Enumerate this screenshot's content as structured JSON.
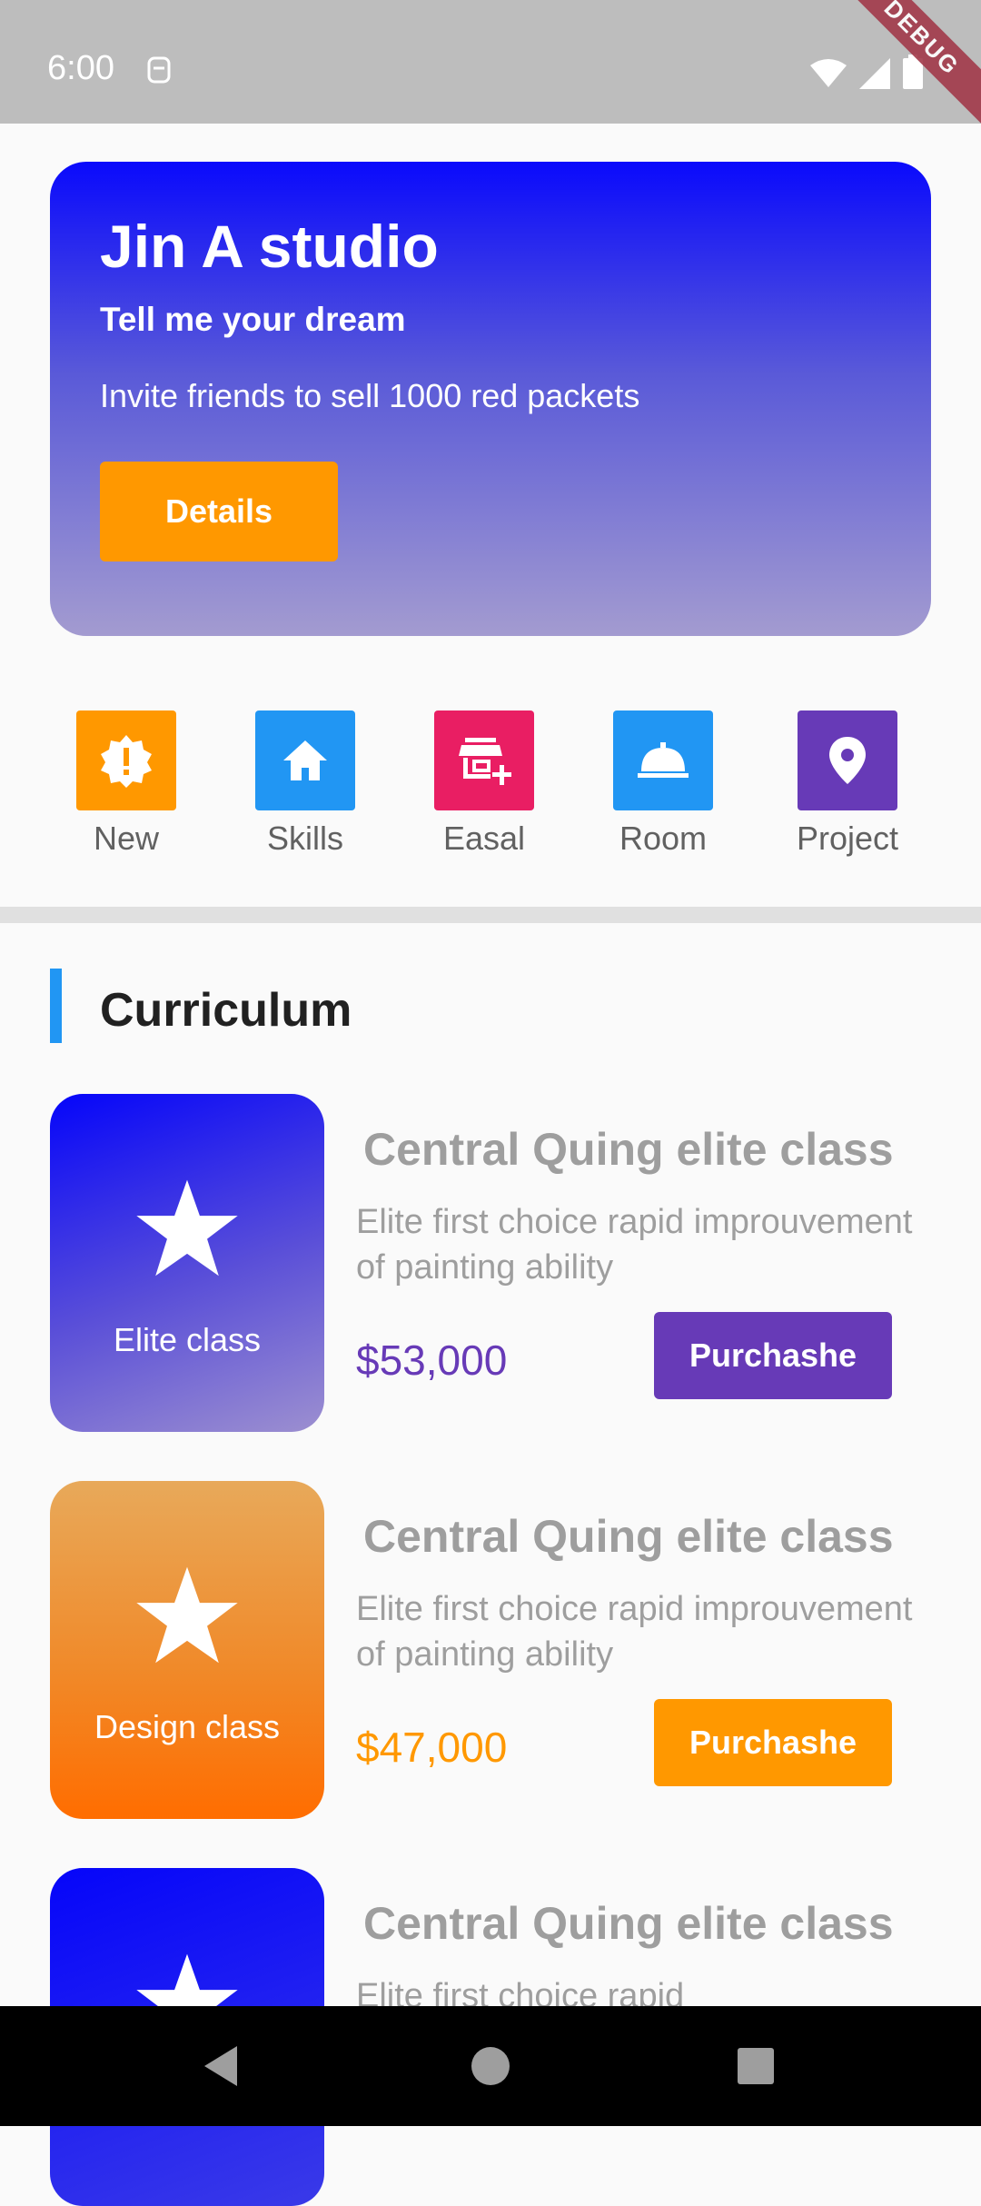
{
  "status_bar": {
    "time": "6:00",
    "background": "#bdbdbd",
    "debug_label": "DEBUG"
  },
  "hero": {
    "title": "Jin A studio",
    "subtitle": "Tell me your dream",
    "description": "Invite friends to sell 1000 red packets",
    "button_label": "Details",
    "gradient": [
      "#0a0afc",
      "#a39bd0"
    ],
    "button_color": "#ff9800"
  },
  "categories": [
    {
      "label": "New",
      "icon": "new-releases-icon",
      "color": "#ff9800"
    },
    {
      "label": "Skills",
      "icon": "home-icon",
      "color": "#2196f3"
    },
    {
      "label": "Easal",
      "icon": "add-business-icon",
      "color": "#e91e63"
    },
    {
      "label": "Room",
      "icon": "room-service-icon",
      "color": "#2196f3"
    },
    {
      "label": "Project",
      "icon": "location-pin-icon",
      "color": "#673ab7"
    }
  ],
  "section": {
    "title": "Curriculum",
    "accent": "#2196f3"
  },
  "courses": [
    {
      "thumb_label": "Elite class",
      "title": "Central Quing elite class",
      "description": "Elite first choice rapid improuvement of painting ability",
      "price": "$53,000",
      "button_label": "Purchashe",
      "accent": "#673ab7"
    },
    {
      "thumb_label": "Design class",
      "title": "Central Quing elite class",
      "description": "Elite first choice rapid improuvement of painting ability",
      "price": "$47,000",
      "button_label": "Purchashe",
      "accent": "#ff9800"
    },
    {
      "thumb_label": "",
      "title": "Central Quing elite class",
      "description": "Elite first choice rapid",
      "price": "",
      "button_label": "",
      "accent": "#673ab7"
    }
  ],
  "nav_bar": {
    "buttons": [
      "back-icon",
      "home-circle-icon",
      "recents-icon"
    ]
  }
}
